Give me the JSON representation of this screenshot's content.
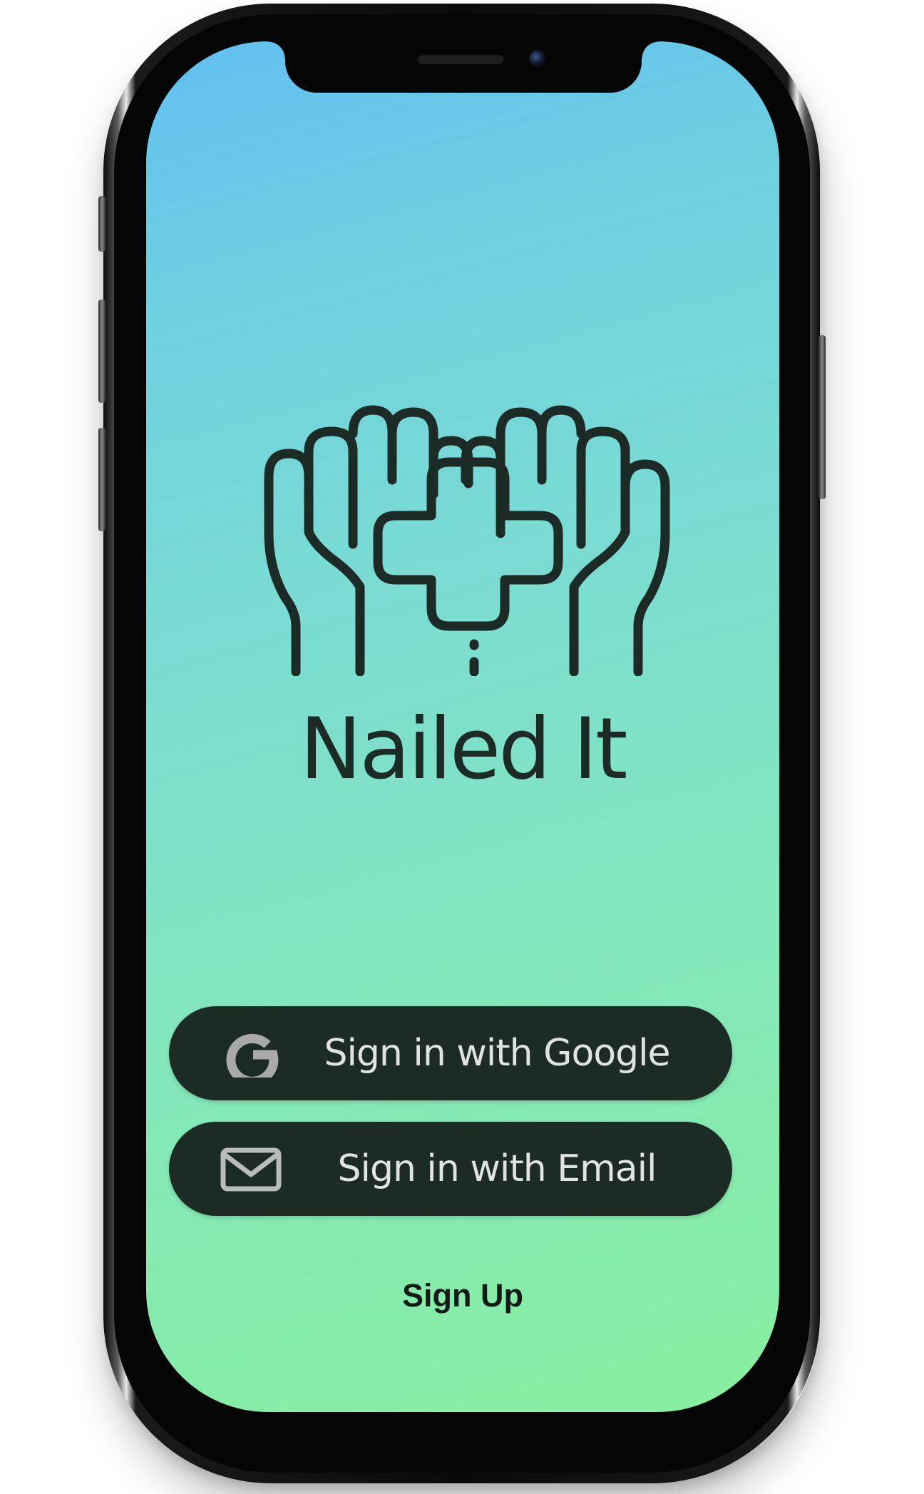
{
  "app": {
    "title": "Nailed It"
  },
  "auth": {
    "google_label": "Sign in with Google",
    "email_label": "Sign in with Email",
    "signup_label": "Sign Up"
  },
  "icons": {
    "logo": "hands-holding-medical-cross-icon",
    "google": "google-g-icon",
    "email": "envelope-icon"
  },
  "colors": {
    "gradient_top": "#62bff2",
    "gradient_bottom": "#88ef9f",
    "button_bg": "#1c2c24",
    "button_text": "#dfe3e1",
    "logo_stroke": "#1d2b26"
  }
}
